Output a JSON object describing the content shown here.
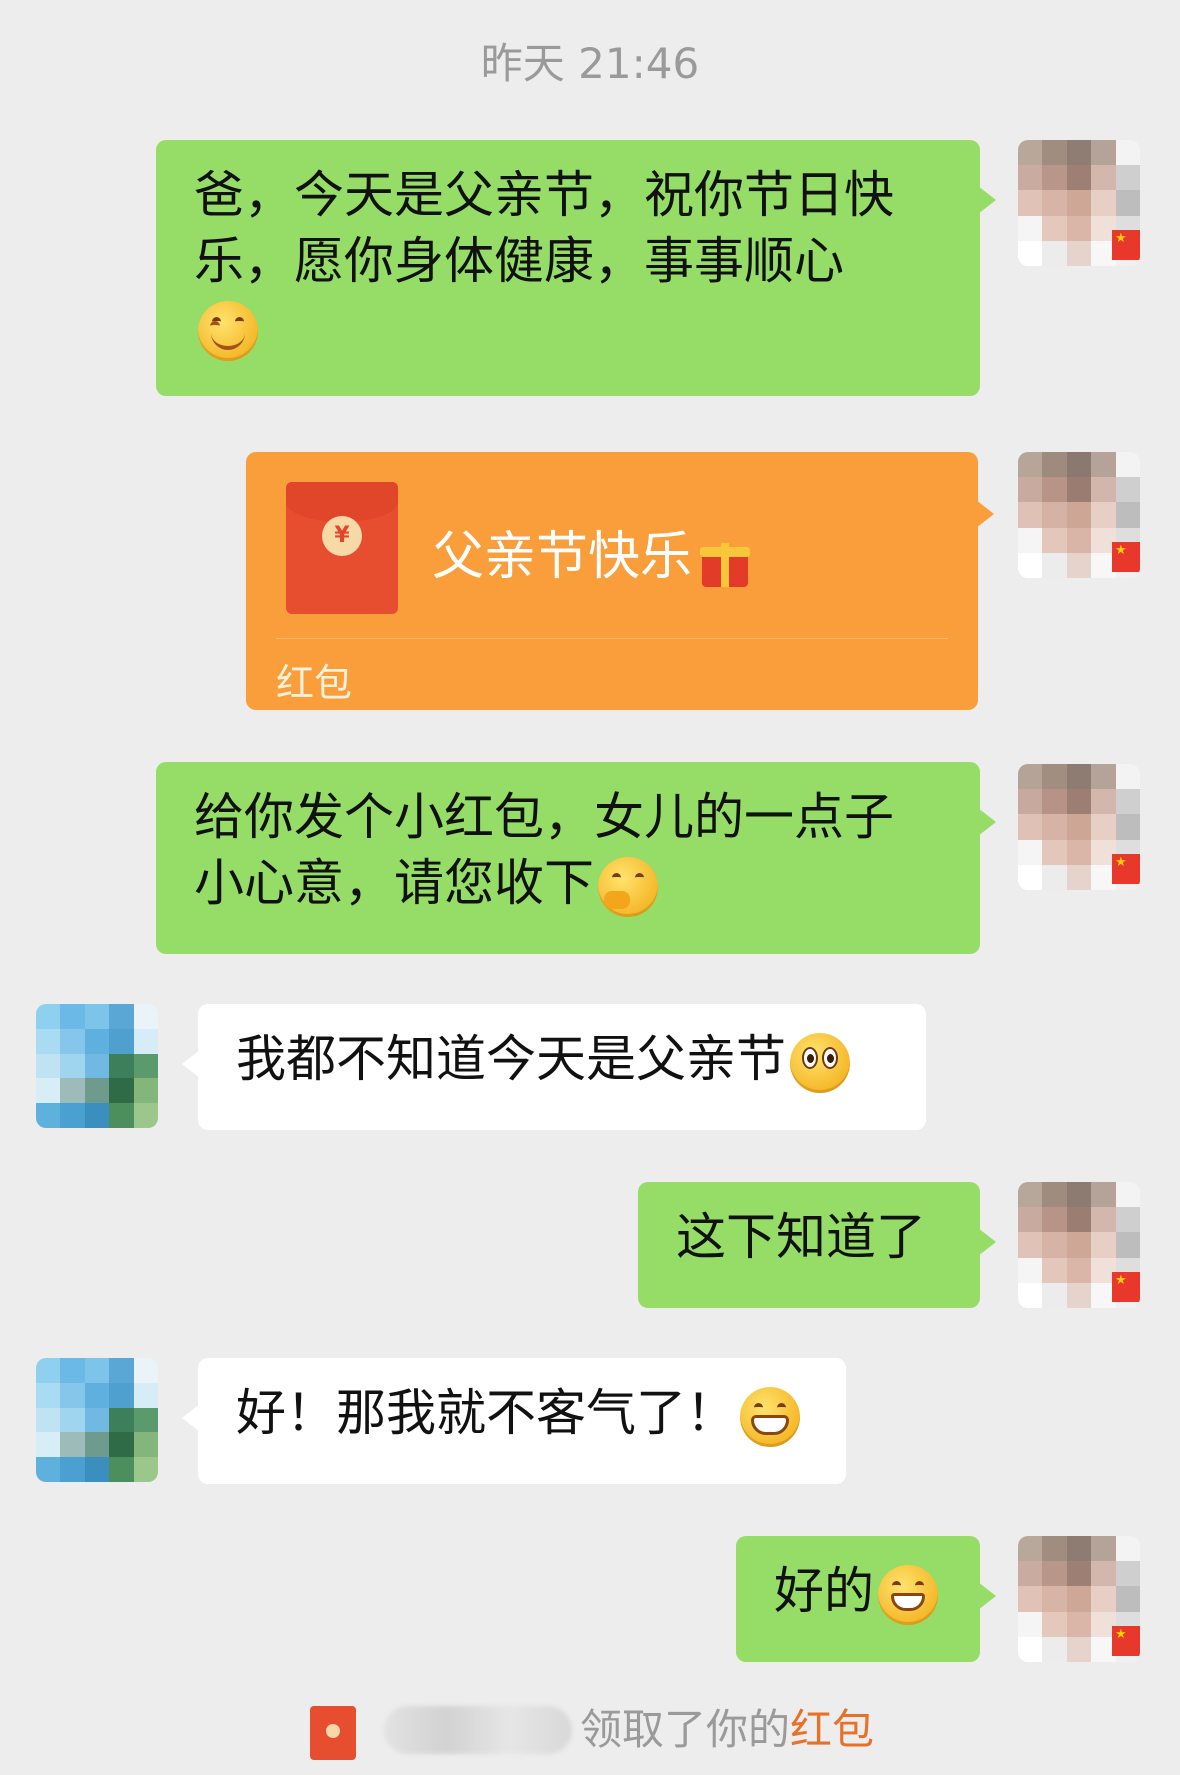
{
  "chat": {
    "timestamp": "昨天 21:46",
    "messages": [
      {
        "side": "right",
        "type": "text",
        "lines": [
          "爸，今天是父亲节，祝你节日快",
          "乐，愿你身体健康，事事顺心"
        ],
        "emoji": "smile-icon"
      },
      {
        "side": "right",
        "type": "redpacket",
        "title": "父亲节快乐",
        "emoji": "gift-icon",
        "label": "红包"
      },
      {
        "side": "right",
        "type": "text",
        "lines": [
          "给你发个小红包，女儿的一点子",
          "小心意，请您收下"
        ],
        "emoji": "thinking-icon"
      },
      {
        "side": "left",
        "type": "text",
        "lines": [
          "我都不知道今天是父亲节"
        ],
        "emoji": "wide-eyed-icon"
      },
      {
        "side": "right",
        "type": "text",
        "lines": [
          "这下知道了"
        ]
      },
      {
        "side": "left",
        "type": "text",
        "lines": [
          "好！那我就不客气了！"
        ],
        "emoji": "grin-icon"
      },
      {
        "side": "right",
        "type": "text",
        "lines": [
          "好的"
        ],
        "emoji": "laugh-icon"
      }
    ],
    "notice": {
      "text": "领取了你的",
      "highlight": "红包"
    }
  },
  "colors": {
    "background": "#ededed",
    "sent_bubble": "#95dd67",
    "received_bubble": "#ffffff",
    "redpacket": "#fa9d3b",
    "highlight": "#e8712a"
  }
}
